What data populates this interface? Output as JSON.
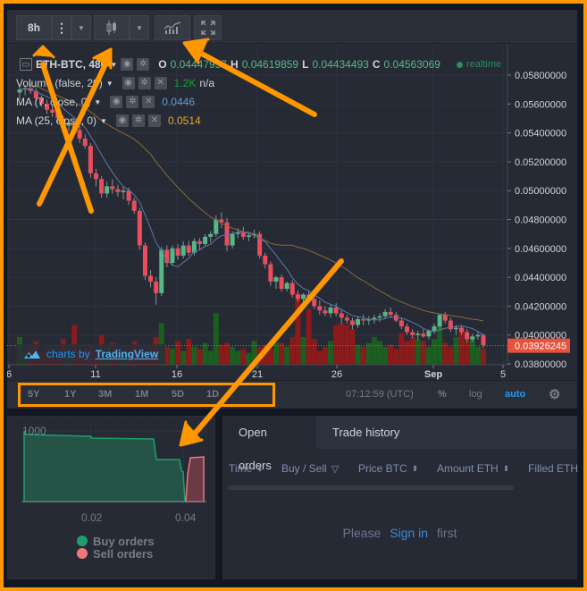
{
  "toolbar": {
    "interval": "8h",
    "icons": [
      "more-vertical-icon",
      "chevron-down-icon",
      "candlestick-icon",
      "chevron-down-icon",
      "indicators-icon",
      "fullscreen-icon"
    ]
  },
  "legend": {
    "symbol": "ETH-BTC, 480",
    "o_label": "O",
    "o_value": "0.04447957",
    "h_label": "H",
    "h_value": "0.04619859",
    "l_label": "L",
    "l_value": "0.04434493",
    "c_label": "C",
    "c_value": "0.04563069",
    "status": "realtime",
    "volume_label": "Volume (false, 20)",
    "volume_value": "1.2K",
    "volume_extra": "n/a",
    "ma7_label": "MA (7, close, 0)",
    "ma7_value": "0.0446",
    "ma25_label": "MA (25, close, 0)",
    "ma25_value": "0.0514"
  },
  "price_axis": {
    "ticks": [
      "0.05800000",
      "0.05600000",
      "0.05400000",
      "0.05200000",
      "0.05000000",
      "0.04800000",
      "0.04600000",
      "0.04400000",
      "0.04200000",
      "0.04000000",
      "0.03800000"
    ],
    "current_price": "0.03926245"
  },
  "time_axis": {
    "ticks": [
      "6",
      "11",
      "16",
      "21",
      "26",
      "Sep",
      "5"
    ]
  },
  "watermark": {
    "prefix": "charts by",
    "brand": "TradingView"
  },
  "bottombar": {
    "ranges": [
      "5Y",
      "1Y",
      "3M",
      "1M",
      "5D",
      "1D"
    ],
    "clock": "07:12:59 (UTC)",
    "percent": "%",
    "log": "log",
    "auto": "auto"
  },
  "colors": {
    "up": "#53b987",
    "down": "#eb4d5c",
    "vol_up": "#1b5e20",
    "vol_down": "#8b1a1a",
    "ma7": "#6a8bbd",
    "ma25": "#a87d3a",
    "accent": "#2196f3",
    "annotation": "#ff9800"
  },
  "depth": {
    "y_label": "1000",
    "x_ticks": [
      "0.02",
      "0.04"
    ],
    "legend": [
      {
        "label": "Buy orders",
        "color": "#1e9e6e"
      },
      {
        "label": "Sell orders",
        "color": "#f07878"
      }
    ]
  },
  "orders": {
    "tabs": [
      "Open orders",
      "Trade history"
    ],
    "active_tab": 0,
    "columns": [
      {
        "label": "Time",
        "icon": "sort-icon"
      },
      {
        "label": "Buy / Sell",
        "icon": "filter-icon"
      },
      {
        "label": "Price BTC",
        "icon": "sort-icon"
      },
      {
        "label": "Amount ETH",
        "icon": "sort-icon"
      },
      {
        "label": "Filled ETH",
        "icon": ""
      }
    ],
    "empty_prefix": "Please",
    "empty_link": "Sign in",
    "empty_suffix": "first"
  },
  "chart_data": {
    "type": "candlestick",
    "title": "ETH-BTC, 480",
    "interval": "8h",
    "ylim": [
      0.0378,
      0.059
    ],
    "x_ticks": [
      "6",
      "11",
      "16",
      "21",
      "26",
      "Sep",
      "5"
    ],
    "candles": [
      [
        0.0568,
        0.0572,
        0.0563,
        0.057
      ],
      [
        0.057,
        0.0573,
        0.0566,
        0.0571
      ],
      [
        0.0571,
        0.0574,
        0.0567,
        0.0569
      ],
      [
        0.0569,
        0.0571,
        0.0562,
        0.0564
      ],
      [
        0.0564,
        0.0566,
        0.0558,
        0.056
      ],
      [
        0.056,
        0.0563,
        0.0553,
        0.0556
      ],
      [
        0.0556,
        0.0559,
        0.0551,
        0.0554
      ],
      [
        0.0554,
        0.0556,
        0.0547,
        0.055
      ],
      [
        0.055,
        0.0552,
        0.0544,
        0.0545
      ],
      [
        0.0545,
        0.0549,
        0.0541,
        0.0547
      ],
      [
        0.0547,
        0.0549,
        0.054,
        0.0542
      ],
      [
        0.0542,
        0.0545,
        0.0533,
        0.0536
      ],
      [
        0.0536,
        0.0539,
        0.0529,
        0.0531
      ],
      [
        0.0531,
        0.0533,
        0.0509,
        0.0512
      ],
      [
        0.0512,
        0.0515,
        0.0503,
        0.0508
      ],
      [
        0.0508,
        0.051,
        0.0495,
        0.0498
      ],
      [
        0.0498,
        0.0506,
        0.0495,
        0.0503
      ],
      [
        0.0503,
        0.0508,
        0.0498,
        0.0501
      ],
      [
        0.0501,
        0.0504,
        0.0496,
        0.0499
      ],
      [
        0.0499,
        0.0503,
        0.0494,
        0.05
      ],
      [
        0.05,
        0.0502,
        0.049,
        0.0493
      ],
      [
        0.0493,
        0.0495,
        0.0484,
        0.0486
      ],
      [
        0.0486,
        0.0488,
        0.0459,
        0.0462
      ],
      [
        0.0462,
        0.0464,
        0.0438,
        0.0441
      ],
      [
        0.0441,
        0.0445,
        0.0433,
        0.0437
      ],
      [
        0.0437,
        0.044,
        0.0421,
        0.0429
      ],
      [
        0.0429,
        0.0461,
        0.0427,
        0.0459
      ],
      [
        0.0459,
        0.0462,
        0.0447,
        0.045
      ],
      [
        0.045,
        0.0462,
        0.0448,
        0.046
      ],
      [
        0.046,
        0.0463,
        0.0452,
        0.0455
      ],
      [
        0.0455,
        0.0465,
        0.0453,
        0.0462
      ],
      [
        0.0462,
        0.0465,
        0.0455,
        0.0457
      ],
      [
        0.0457,
        0.0467,
        0.0455,
        0.0465
      ],
      [
        0.0465,
        0.0467,
        0.0459,
        0.0463
      ],
      [
        0.0463,
        0.047,
        0.0461,
        0.0468
      ],
      [
        0.0468,
        0.0472,
        0.0464,
        0.047
      ],
      [
        0.047,
        0.0483,
        0.0468,
        0.048
      ],
      [
        0.048,
        0.0485,
        0.0474,
        0.0478
      ],
      [
        0.0478,
        0.0481,
        0.0458,
        0.0462
      ],
      [
        0.0462,
        0.0472,
        0.046,
        0.047
      ],
      [
        0.047,
        0.0474,
        0.0467,
        0.0471
      ],
      [
        0.0471,
        0.0475,
        0.0466,
        0.0468
      ],
      [
        0.0468,
        0.0471,
        0.0465,
        0.0469
      ],
      [
        0.0469,
        0.0473,
        0.0467,
        0.047
      ],
      [
        0.047,
        0.0472,
        0.0453,
        0.0455
      ],
      [
        0.0455,
        0.0457,
        0.0446,
        0.0449
      ],
      [
        0.0449,
        0.0451,
        0.0434,
        0.0437
      ],
      [
        0.0437,
        0.0441,
        0.0432,
        0.044
      ],
      [
        0.044,
        0.0442,
        0.043,
        0.0432
      ],
      [
        0.0432,
        0.0437,
        0.043,
        0.0436
      ],
      [
        0.0436,
        0.0438,
        0.0426,
        0.0428
      ],
      [
        0.0428,
        0.0431,
        0.0423,
        0.0425
      ],
      [
        0.0425,
        0.0429,
        0.0419,
        0.0428
      ],
      [
        0.0428,
        0.0431,
        0.0423,
        0.0425
      ],
      [
        0.0425,
        0.0428,
        0.0418,
        0.042
      ],
      [
        0.042,
        0.0424,
        0.0414,
        0.0417
      ],
      [
        0.0417,
        0.042,
        0.0413,
        0.0415
      ],
      [
        0.0415,
        0.0421,
        0.0412,
        0.0419
      ],
      [
        0.0419,
        0.0422,
        0.0413,
        0.0415
      ],
      [
        0.0415,
        0.0418,
        0.0408,
        0.0412
      ],
      [
        0.0412,
        0.0414,
        0.0408,
        0.041
      ],
      [
        0.041,
        0.0412,
        0.0404,
        0.0407
      ],
      [
        0.0407,
        0.0413,
        0.0405,
        0.0411
      ],
      [
        0.0411,
        0.0414,
        0.0407,
        0.041
      ],
      [
        0.041,
        0.0413,
        0.0407,
        0.0411
      ],
      [
        0.0411,
        0.0414,
        0.0408,
        0.0412
      ],
      [
        0.0412,
        0.0415,
        0.0409,
        0.0413
      ],
      [
        0.0413,
        0.0418,
        0.0411,
        0.0416
      ],
      [
        0.0416,
        0.0419,
        0.0412,
        0.0414
      ],
      [
        0.0414,
        0.0416,
        0.0409,
        0.041
      ],
      [
        0.041,
        0.0412,
        0.0404,
        0.0406
      ],
      [
        0.0406,
        0.0408,
        0.04,
        0.0402
      ],
      [
        0.0402,
        0.0404,
        0.0398,
        0.04
      ],
      [
        0.04,
        0.0403,
        0.0397,
        0.0401
      ],
      [
        0.0401,
        0.0404,
        0.0398,
        0.0399
      ],
      [
        0.0399,
        0.0404,
        0.0397,
        0.0403
      ],
      [
        0.0403,
        0.0408,
        0.0401,
        0.0406
      ],
      [
        0.0406,
        0.0415,
        0.0404,
        0.0414
      ],
      [
        0.0414,
        0.0416,
        0.0408,
        0.041
      ],
      [
        0.041,
        0.0412,
        0.0402,
        0.0404
      ],
      [
        0.0404,
        0.0407,
        0.04,
        0.0405
      ],
      [
        0.0405,
        0.0407,
        0.04,
        0.0402
      ],
      [
        0.0402,
        0.0404,
        0.0395,
        0.0397
      ],
      [
        0.0397,
        0.0401,
        0.0395,
        0.0399
      ],
      [
        0.0399,
        0.0402,
        0.0397,
        0.04
      ],
      [
        0.04,
        0.0401,
        0.0391,
        0.0393
      ]
    ],
    "volume": [
      140,
      60,
      90,
      120,
      60,
      80,
      50,
      70,
      130,
      60,
      200,
      70,
      80,
      100,
      60,
      150,
      90,
      110,
      70,
      60,
      80,
      120,
      90,
      60,
      100,
      140,
      210,
      90,
      80,
      120,
      70,
      130,
      90,
      80,
      110,
      70,
      260,
      100,
      110,
      90,
      70,
      80,
      60,
      120,
      90,
      100,
      80,
      110,
      110,
      90,
      140,
      360,
      140,
      280,
      130,
      70,
      90,
      120,
      200,
      210,
      200,
      180,
      100,
      90,
      110,
      140,
      120,
      90,
      100,
      80,
      160,
      120,
      140,
      130,
      120,
      90,
      130,
      200,
      110,
      90,
      140,
      190,
      120,
      130,
      90,
      80
    ],
    "ma7": [
      0.0446
    ],
    "ma25": [
      0.0514
    ]
  }
}
